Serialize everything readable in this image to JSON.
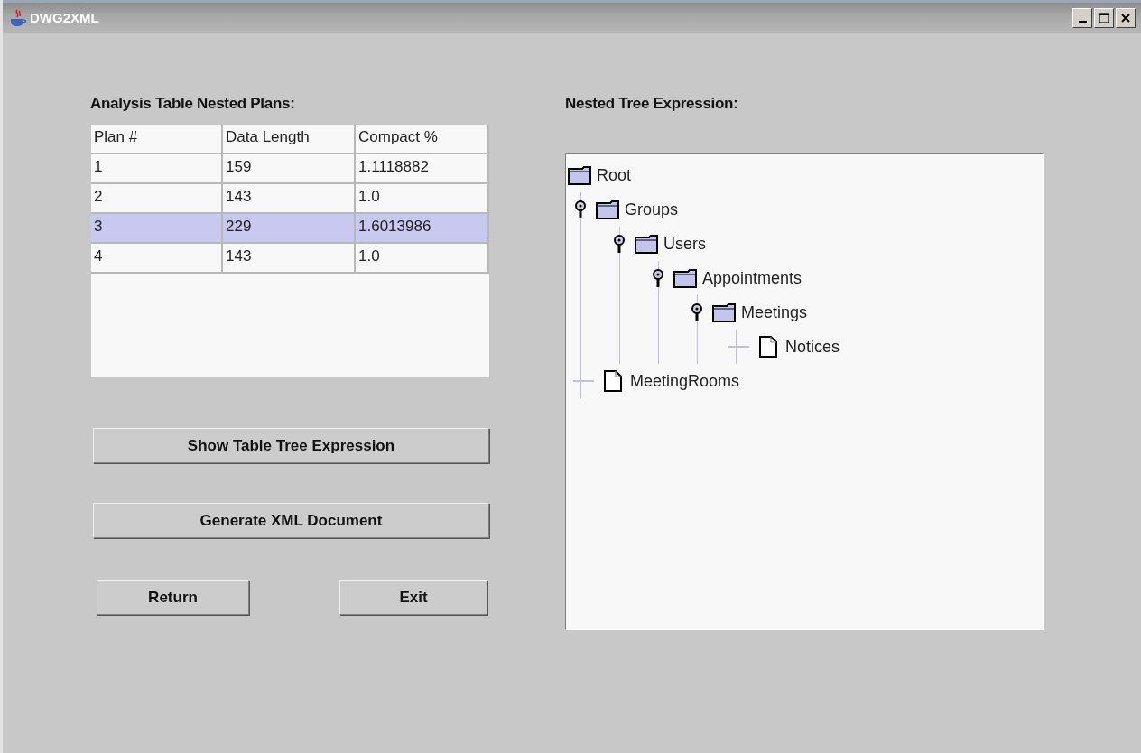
{
  "window": {
    "title": "DWG2XML"
  },
  "table": {
    "title": "Analysis Table Nested Plans:",
    "columns": [
      "Plan #",
      "Data Length",
      "Compact %"
    ],
    "rows": [
      {
        "cells": [
          "1",
          "159",
          "1.1118882"
        ],
        "selected": false
      },
      {
        "cells": [
          "2",
          "143",
          "1.0"
        ],
        "selected": false
      },
      {
        "cells": [
          "3",
          "229",
          "1.6013986"
        ],
        "selected": true
      },
      {
        "cells": [
          "4",
          "143",
          "1.0"
        ],
        "selected": false
      }
    ]
  },
  "buttons": [
    {
      "kind": "wide",
      "label": "Show Table Tree Expression"
    },
    {
      "kind": "wide",
      "label": "Generate XML Document"
    },
    {
      "kind": "small",
      "label": "Return"
    },
    {
      "kind": "small",
      "label": "Exit"
    }
  ],
  "tree": {
    "title": "Nested Tree Expression:",
    "root": {
      "label": "Root",
      "kind": "folder",
      "children": [
        {
          "label": "Groups",
          "kind": "folder",
          "expanded": true,
          "children": [
            {
              "label": "Users",
              "kind": "folder",
              "expanded": true,
              "children": [
                {
                  "label": "Appointments",
                  "kind": "folder",
                  "expanded": true,
                  "children": [
                    {
                      "label": "Meetings",
                      "kind": "folder",
                      "expanded": true,
                      "children": [
                        {
                          "label": "Notices",
                          "kind": "document"
                        }
                      ]
                    }
                  ]
                }
              ]
            }
          ]
        },
        {
          "label": "MeetingRooms",
          "kind": "document"
        }
      ]
    }
  }
}
